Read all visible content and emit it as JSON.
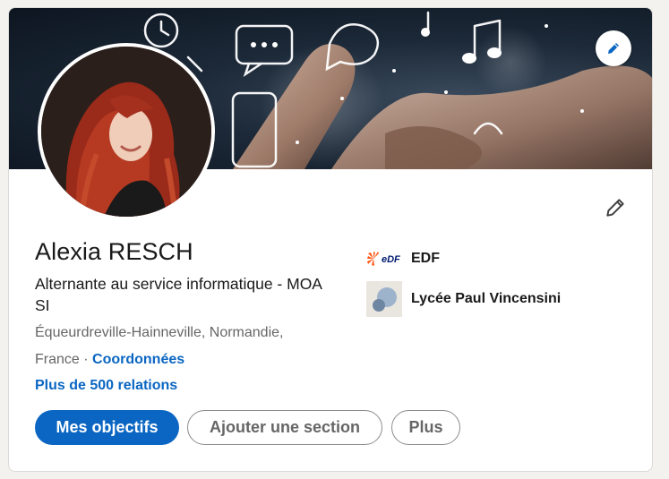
{
  "profile": {
    "name": "Alexia RESCH",
    "headline": "Alternante au service informatique - MOA SI",
    "location": "Équeurdreville-Hainneville, Normandie, France",
    "location_separator": " · ",
    "contact_link": "Coordonnées",
    "connections": "Plus de 500 relations"
  },
  "actions": {
    "primary_label": "Mes objectifs",
    "add_section_label": "Ajouter une section",
    "more_label": "Plus"
  },
  "experience": {
    "company_name": "EDF",
    "company_logo_text": "eDF",
    "school_name": "Lycée Paul Vincensini"
  },
  "icons": {
    "banner_edit": "pencil-icon",
    "profile_edit": "pencil-icon",
    "company_logo": "edf-logo",
    "school_logo": "school-logo"
  },
  "colors": {
    "accent": "#0a66c2",
    "text_primary": "#191919",
    "text_secondary": "#666666",
    "edf_orange": "#fe5815",
    "edf_blue": "#001a70"
  }
}
